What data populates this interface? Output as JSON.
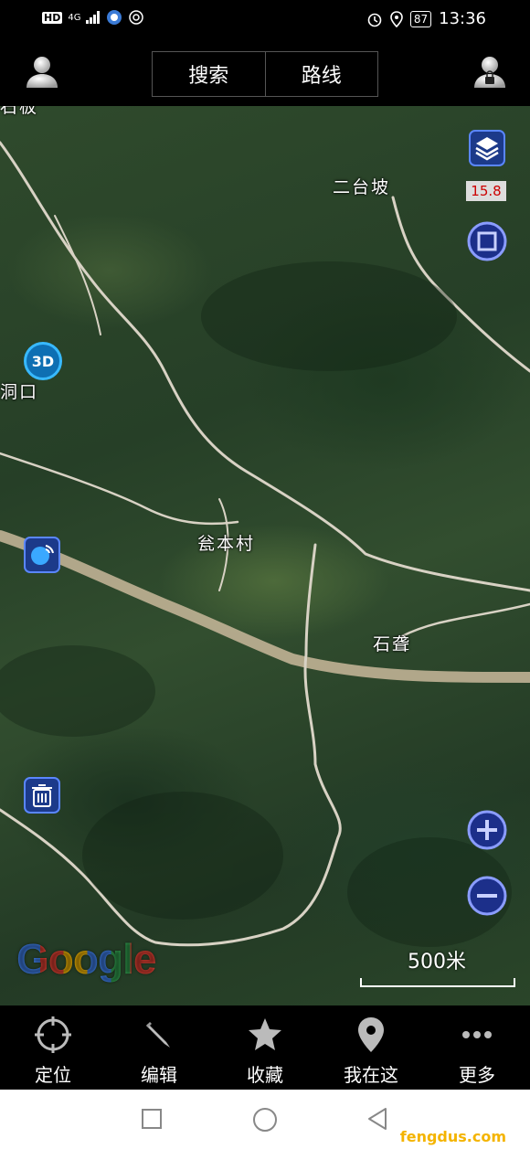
{
  "status_bar": {
    "network_hd": "HD",
    "network_gen": "4G",
    "battery": "87",
    "time": "13:36"
  },
  "top_bar": {
    "search_label": "搜索",
    "route_label": "路线"
  },
  "map": {
    "zoom_level": "15.8",
    "mode_3d": "3D",
    "scale": "500米",
    "logo": "Google",
    "labels": {
      "ertaipo": "二台坡",
      "wengbencun": "瓮本村",
      "shipeng": "石聋",
      "edge_top": "石板",
      "edge_left": "洞口"
    }
  },
  "bottom_nav": [
    {
      "label": "定位",
      "icon": "locate-icon"
    },
    {
      "label": "编辑",
      "icon": "pencil-icon"
    },
    {
      "label": "收藏",
      "icon": "star-icon"
    },
    {
      "label": "我在这",
      "icon": "pin-icon"
    },
    {
      "label": "更多",
      "icon": "more-icon"
    }
  ],
  "watermark": "fengdus.com"
}
